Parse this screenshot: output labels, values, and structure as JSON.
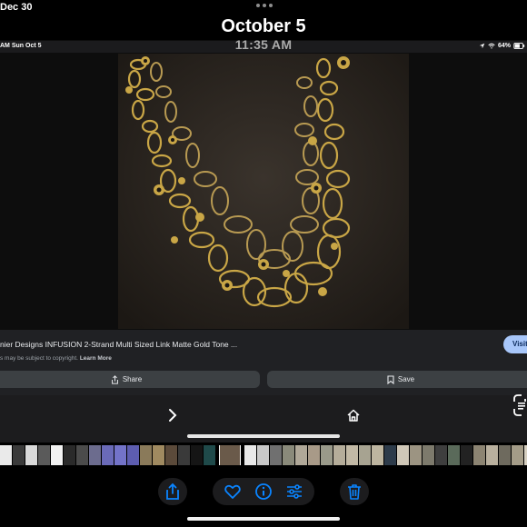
{
  "top": {
    "prev_date": "Dec 30",
    "title_date": "October 5",
    "title_time": "11:35 AM"
  },
  "status_bar": {
    "left": "AM   Sun Oct 5",
    "battery": "64%"
  },
  "result": {
    "title": "nier Designs INFUSION 2-Strand Multi Sized Link Matte Gold Tone ...",
    "copyright_text": "s may be subject to copyright.",
    "learn_more": "Learn More",
    "visit_label": "Visit",
    "share_label": "Share",
    "save_label": "Save"
  },
  "colors": {
    "accent": "#0a84ff",
    "visit_button": "#a8c7fa",
    "panel": "#202124",
    "action_button": "#3c4043"
  },
  "browser_nav": {
    "icons": [
      "chevron-right-icon",
      "home-icon",
      "lens-icon"
    ]
  },
  "filmstrip": {
    "thumbnail_count": 42
  },
  "toolbar": {
    "icons": [
      "share-icon",
      "heart-icon",
      "info-icon",
      "adjust-icon",
      "trash-icon"
    ]
  }
}
